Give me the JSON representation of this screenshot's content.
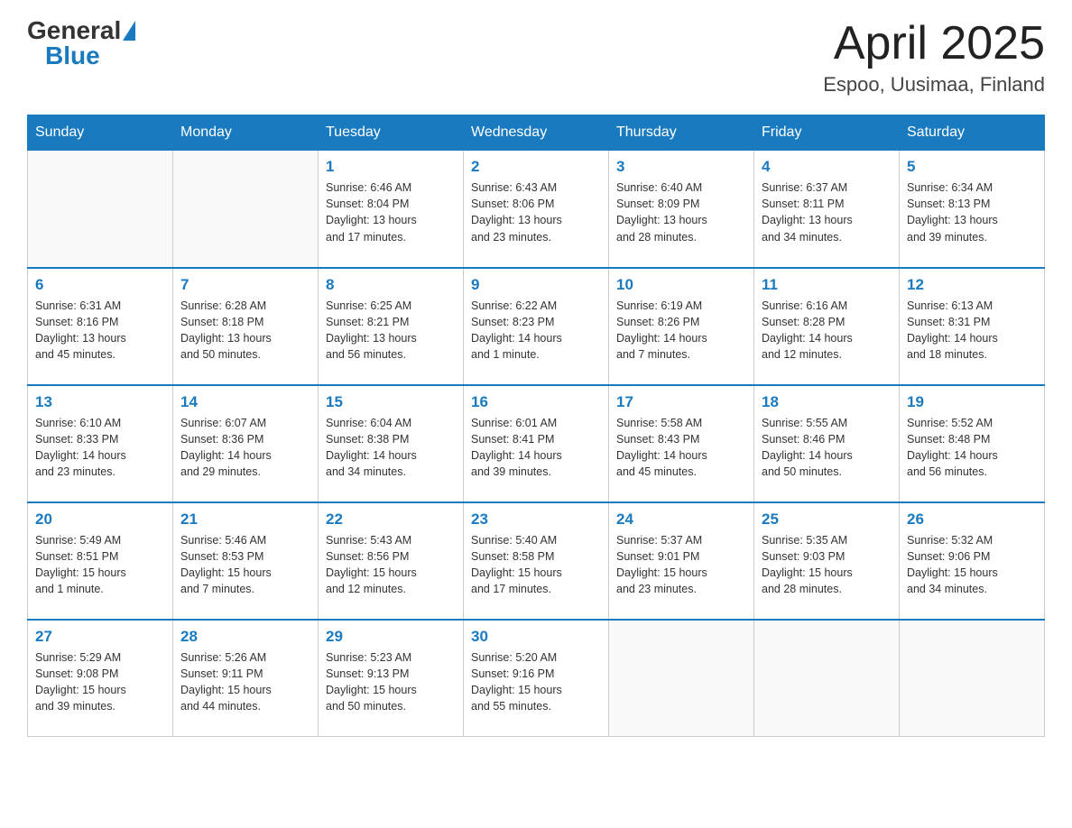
{
  "header": {
    "logo_general": "General",
    "logo_blue": "Blue",
    "month_year": "April 2025",
    "location": "Espoo, Uusimaa, Finland"
  },
  "days_of_week": [
    "Sunday",
    "Monday",
    "Tuesday",
    "Wednesday",
    "Thursday",
    "Friday",
    "Saturday"
  ],
  "weeks": [
    [
      {
        "day": "",
        "info": ""
      },
      {
        "day": "",
        "info": ""
      },
      {
        "day": "1",
        "info": "Sunrise: 6:46 AM\nSunset: 8:04 PM\nDaylight: 13 hours\nand 17 minutes."
      },
      {
        "day": "2",
        "info": "Sunrise: 6:43 AM\nSunset: 8:06 PM\nDaylight: 13 hours\nand 23 minutes."
      },
      {
        "day": "3",
        "info": "Sunrise: 6:40 AM\nSunset: 8:09 PM\nDaylight: 13 hours\nand 28 minutes."
      },
      {
        "day": "4",
        "info": "Sunrise: 6:37 AM\nSunset: 8:11 PM\nDaylight: 13 hours\nand 34 minutes."
      },
      {
        "day": "5",
        "info": "Sunrise: 6:34 AM\nSunset: 8:13 PM\nDaylight: 13 hours\nand 39 minutes."
      }
    ],
    [
      {
        "day": "6",
        "info": "Sunrise: 6:31 AM\nSunset: 8:16 PM\nDaylight: 13 hours\nand 45 minutes."
      },
      {
        "day": "7",
        "info": "Sunrise: 6:28 AM\nSunset: 8:18 PM\nDaylight: 13 hours\nand 50 minutes."
      },
      {
        "day": "8",
        "info": "Sunrise: 6:25 AM\nSunset: 8:21 PM\nDaylight: 13 hours\nand 56 minutes."
      },
      {
        "day": "9",
        "info": "Sunrise: 6:22 AM\nSunset: 8:23 PM\nDaylight: 14 hours\nand 1 minute."
      },
      {
        "day": "10",
        "info": "Sunrise: 6:19 AM\nSunset: 8:26 PM\nDaylight: 14 hours\nand 7 minutes."
      },
      {
        "day": "11",
        "info": "Sunrise: 6:16 AM\nSunset: 8:28 PM\nDaylight: 14 hours\nand 12 minutes."
      },
      {
        "day": "12",
        "info": "Sunrise: 6:13 AM\nSunset: 8:31 PM\nDaylight: 14 hours\nand 18 minutes."
      }
    ],
    [
      {
        "day": "13",
        "info": "Sunrise: 6:10 AM\nSunset: 8:33 PM\nDaylight: 14 hours\nand 23 minutes."
      },
      {
        "day": "14",
        "info": "Sunrise: 6:07 AM\nSunset: 8:36 PM\nDaylight: 14 hours\nand 29 minutes."
      },
      {
        "day": "15",
        "info": "Sunrise: 6:04 AM\nSunset: 8:38 PM\nDaylight: 14 hours\nand 34 minutes."
      },
      {
        "day": "16",
        "info": "Sunrise: 6:01 AM\nSunset: 8:41 PM\nDaylight: 14 hours\nand 39 minutes."
      },
      {
        "day": "17",
        "info": "Sunrise: 5:58 AM\nSunset: 8:43 PM\nDaylight: 14 hours\nand 45 minutes."
      },
      {
        "day": "18",
        "info": "Sunrise: 5:55 AM\nSunset: 8:46 PM\nDaylight: 14 hours\nand 50 minutes."
      },
      {
        "day": "19",
        "info": "Sunrise: 5:52 AM\nSunset: 8:48 PM\nDaylight: 14 hours\nand 56 minutes."
      }
    ],
    [
      {
        "day": "20",
        "info": "Sunrise: 5:49 AM\nSunset: 8:51 PM\nDaylight: 15 hours\nand 1 minute."
      },
      {
        "day": "21",
        "info": "Sunrise: 5:46 AM\nSunset: 8:53 PM\nDaylight: 15 hours\nand 7 minutes."
      },
      {
        "day": "22",
        "info": "Sunrise: 5:43 AM\nSunset: 8:56 PM\nDaylight: 15 hours\nand 12 minutes."
      },
      {
        "day": "23",
        "info": "Sunrise: 5:40 AM\nSunset: 8:58 PM\nDaylight: 15 hours\nand 17 minutes."
      },
      {
        "day": "24",
        "info": "Sunrise: 5:37 AM\nSunset: 9:01 PM\nDaylight: 15 hours\nand 23 minutes."
      },
      {
        "day": "25",
        "info": "Sunrise: 5:35 AM\nSunset: 9:03 PM\nDaylight: 15 hours\nand 28 minutes."
      },
      {
        "day": "26",
        "info": "Sunrise: 5:32 AM\nSunset: 9:06 PM\nDaylight: 15 hours\nand 34 minutes."
      }
    ],
    [
      {
        "day": "27",
        "info": "Sunrise: 5:29 AM\nSunset: 9:08 PM\nDaylight: 15 hours\nand 39 minutes."
      },
      {
        "day": "28",
        "info": "Sunrise: 5:26 AM\nSunset: 9:11 PM\nDaylight: 15 hours\nand 44 minutes."
      },
      {
        "day": "29",
        "info": "Sunrise: 5:23 AM\nSunset: 9:13 PM\nDaylight: 15 hours\nand 50 minutes."
      },
      {
        "day": "30",
        "info": "Sunrise: 5:20 AM\nSunset: 9:16 PM\nDaylight: 15 hours\nand 55 minutes."
      },
      {
        "day": "",
        "info": ""
      },
      {
        "day": "",
        "info": ""
      },
      {
        "day": "",
        "info": ""
      }
    ]
  ]
}
